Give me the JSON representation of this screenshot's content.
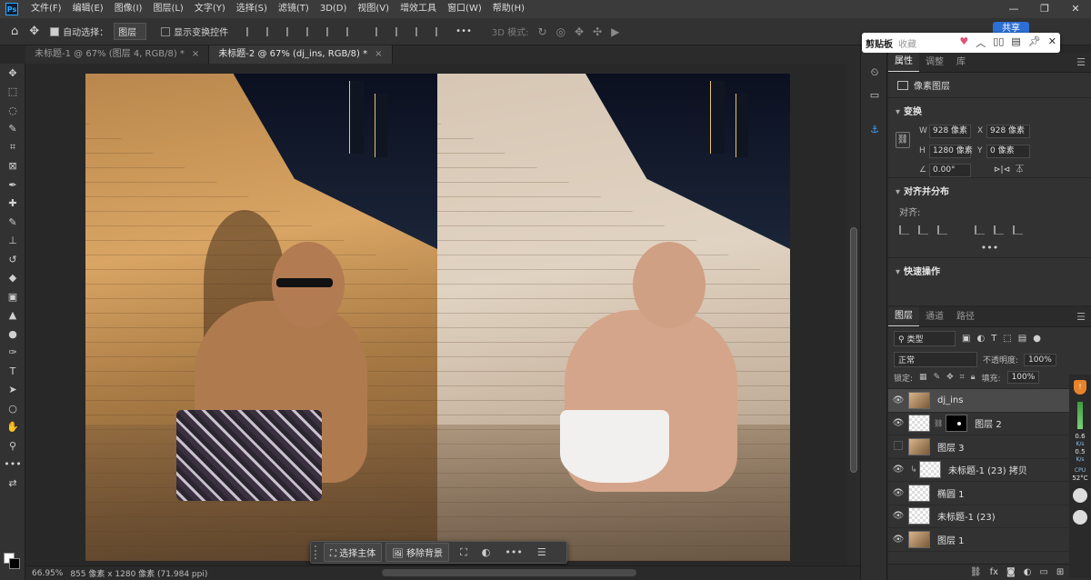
{
  "app": {
    "logo": "Ps"
  },
  "menu": [
    "文件(F)",
    "编辑(E)",
    "图像(I)",
    "图层(L)",
    "文字(Y)",
    "选择(S)",
    "滤镜(T)",
    "3D(D)",
    "视图(V)",
    "增效工具",
    "窗口(W)",
    "帮助(H)"
  ],
  "window_controls": {
    "minimize": "—",
    "restore": "❐",
    "close": "✕"
  },
  "options": {
    "auto_select_label": "自动选择：",
    "auto_select_value": "图层",
    "show_transform_label": "显示变换控件",
    "mode_label": "3D 模式:",
    "more": "•••",
    "share_label": "共享"
  },
  "clipboard_popup": {
    "title": "剪贴板",
    "favorites": "收藏"
  },
  "tabs": [
    {
      "label": "未标题-1 @ 67% (图层 4, RGB/8) *",
      "close": "×"
    },
    {
      "label": "未标题-2 @ 67% (dj_ins, RGB/8) *",
      "close": "×"
    }
  ],
  "task_bar": {
    "select_subject": "选择主体",
    "remove_bg": "移除背景",
    "more": "•••"
  },
  "status": {
    "zoom": "66.95%",
    "doc_info": "855 像素 x 1280 像素 (71.984 ppi)"
  },
  "properties": {
    "tabs": [
      "属性",
      "调整",
      "库"
    ],
    "layer_type": "像素图层",
    "transform_title": "变换",
    "w": "928 像素",
    "x": "928 像素",
    "h": "1280 像素",
    "y": "0 像素",
    "angle": "0.00°",
    "labels": {
      "w": "W",
      "h": "H",
      "x": "X",
      "y": "Y"
    },
    "align_title": "对齐并分布",
    "align_label": "对齐:",
    "quick_actions_title": "快速操作",
    "more": "•••"
  },
  "layers_panel": {
    "tabs": [
      "图层",
      "通道",
      "路径"
    ],
    "filter_kind": "类型",
    "blend_mode": "正常",
    "opacity_label": "不透明度:",
    "opacity_value": "100%",
    "lock_label": "锁定:",
    "fill_label": "填充:",
    "fill_value": "100%",
    "layers": [
      {
        "name": "dj_ins",
        "visible": true,
        "selected": true,
        "thumb": "photo"
      },
      {
        "name": "图层 2",
        "visible": true,
        "selected": false,
        "thumb": "checker",
        "mask": true
      },
      {
        "name": "图层 3",
        "visible": false,
        "selected": false,
        "thumb": "photo"
      },
      {
        "name": "未标题-1 (23) 拷贝",
        "visible": true,
        "selected": false,
        "thumb": "checker",
        "clipped": true
      },
      {
        "name": "椭圆 1",
        "visible": true,
        "selected": false,
        "thumb": "checker"
      },
      {
        "name": "未标题-1 (23)",
        "visible": true,
        "selected": false,
        "thumb": "checker"
      },
      {
        "name": "图层 1",
        "visible": true,
        "selected": false,
        "thumb": "photo"
      }
    ]
  },
  "perf_monitor": {
    "up_value": "0.6",
    "up_unit": "K/s",
    "down_value": "0.5",
    "down_unit": "K/s",
    "cpu_label": "CPU",
    "cpu_temp": "52°C"
  }
}
